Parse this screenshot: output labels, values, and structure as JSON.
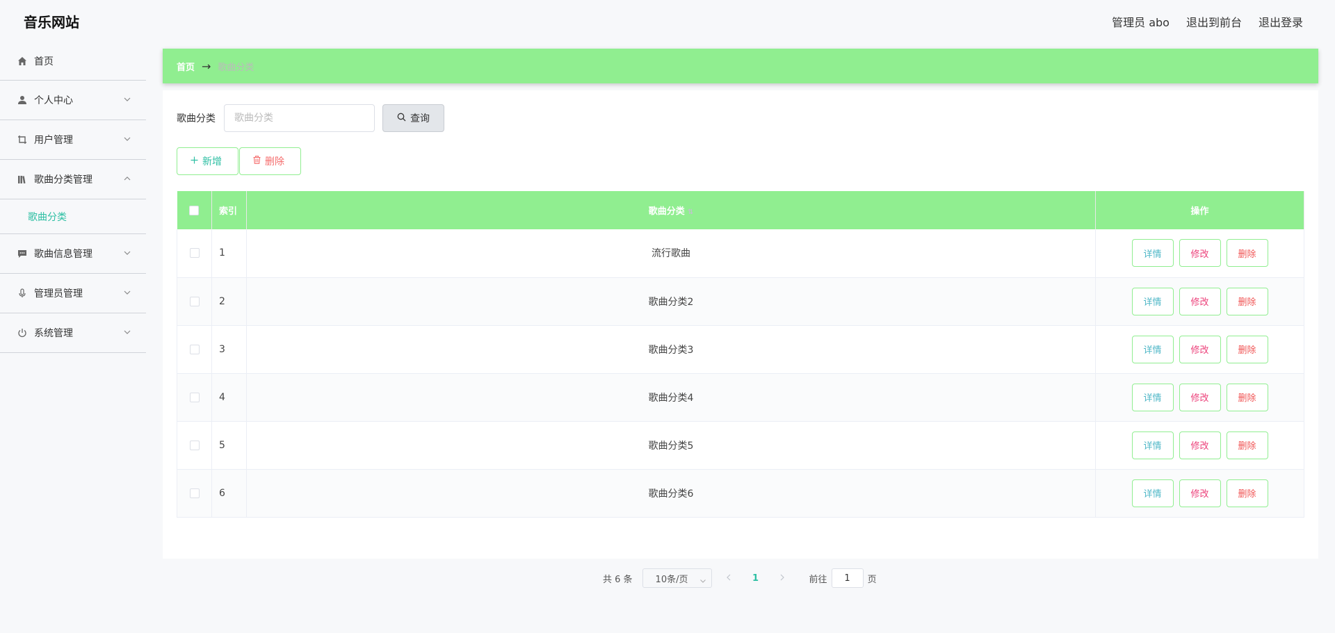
{
  "header": {
    "title": "音乐网站",
    "user": "管理员 abo",
    "to_front": "退出到前台",
    "logout": "退出登录"
  },
  "sidebar": {
    "items": [
      {
        "label": "首页",
        "icon": "home-icon"
      },
      {
        "label": "个人中心",
        "icon": "user-icon",
        "expandable": true
      },
      {
        "label": "用户管理",
        "icon": "crop-icon",
        "expandable": true
      },
      {
        "label": "歌曲分类管理",
        "icon": "library-icon",
        "expandable": true,
        "expanded": true
      },
      {
        "label": "歌曲信息管理",
        "icon": "chat-icon",
        "expandable": true
      },
      {
        "label": "管理员管理",
        "icon": "mic-icon",
        "expandable": true
      },
      {
        "label": "系统管理",
        "icon": "power-icon",
        "expandable": true
      }
    ],
    "subitem": "歌曲分类"
  },
  "breadcrumb": {
    "home": "首页",
    "separator": "→",
    "current": "歌曲分类"
  },
  "search": {
    "label": "歌曲分类",
    "placeholder": "歌曲分类",
    "value": "",
    "button": "查询"
  },
  "actions": {
    "add": "新增",
    "delete": "删除"
  },
  "table": {
    "headers": {
      "index": "索引",
      "name": "歌曲分类",
      "ops": "操作"
    },
    "rows": [
      {
        "index": "1",
        "name": "流行歌曲"
      },
      {
        "index": "2",
        "name": "歌曲分类2"
      },
      {
        "index": "3",
        "name": "歌曲分类3"
      },
      {
        "index": "4",
        "name": "歌曲分类4"
      },
      {
        "index": "5",
        "name": "歌曲分类5"
      },
      {
        "index": "6",
        "name": "歌曲分类6"
      }
    ],
    "op_labels": {
      "detail": "详情",
      "edit": "修改",
      "delete": "删除"
    }
  },
  "pagination": {
    "total": "共 6 条",
    "page_size": "10条/页",
    "current_page": "1",
    "goto_label": "前往",
    "goto_value": "1",
    "goto_suffix": "页"
  },
  "colors": {
    "accent_green": "#90ee90",
    "teal": "#2dbfa3",
    "danger": "#f56c6c"
  }
}
